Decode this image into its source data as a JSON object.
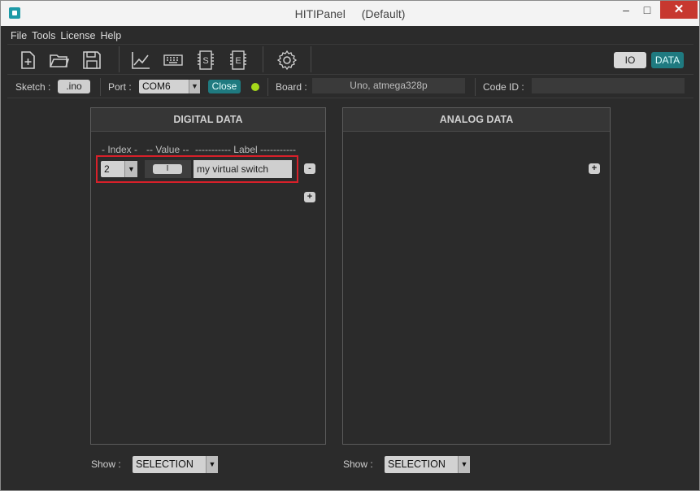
{
  "window": {
    "app_name": "HITIPanel",
    "profile": "(Default)",
    "minimize": "–",
    "maximize": "□",
    "close": "✕"
  },
  "menu": [
    "File",
    "Tools",
    "License",
    "Help"
  ],
  "toolbar": {
    "icons": [
      "new-file-icon",
      "open-folder-icon",
      "save-icon",
      "chart-icon",
      "keyboard-icon",
      "sketch-icon",
      "eeprom-icon",
      "settings-icon"
    ],
    "view_io": "IO",
    "view_data": "DATA"
  },
  "infobar": {
    "sketch_label": "Sketch :",
    "sketch_value": ".ino",
    "port_label": "Port :",
    "port_value": "COM6",
    "close_label": "Close",
    "board_label": "Board :",
    "board_value": "Uno, atmega328p",
    "code_id_label": "Code ID :",
    "code_id_value": ""
  },
  "digital": {
    "title": "DIGITAL  DATA",
    "col_index": "- Index -",
    "col_value": "-- Value --",
    "col_label": "----------- Label -----------",
    "row": {
      "index": "2",
      "value": "I",
      "label": "my virtual switch"
    },
    "remove": "-",
    "add": "+",
    "show_label": "Show :",
    "show_value": "SELECTION"
  },
  "analog": {
    "title": "ANALOG  DATA",
    "add": "+",
    "show_label": "Show :",
    "show_value": "SELECTION"
  },
  "colors": {
    "accent": "#1f7a80",
    "highlight": "#d8202a",
    "led": "#a5d81a"
  }
}
